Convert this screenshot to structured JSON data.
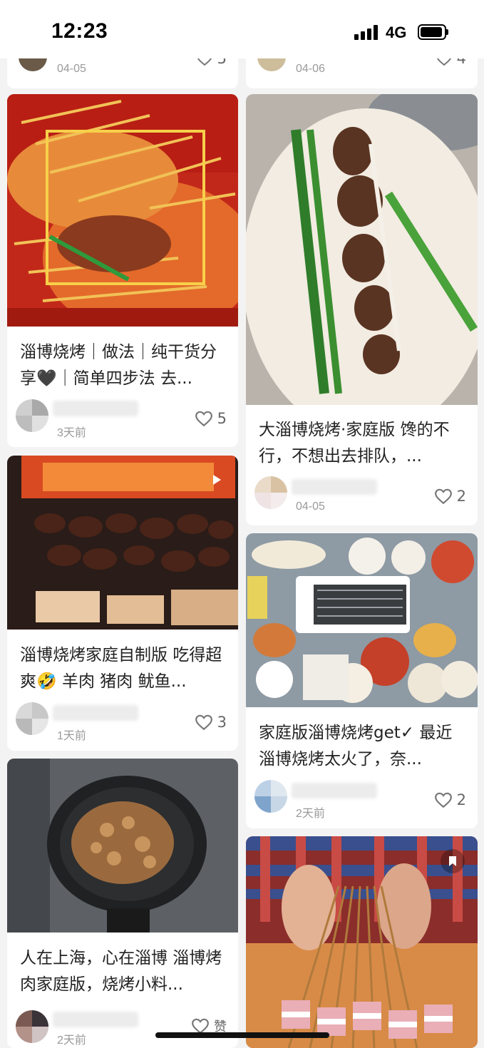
{
  "status_bar": {
    "time": "12:23",
    "network": "4G"
  },
  "feed": {
    "left": [
      {
        "date": "04-05",
        "likes": "5"
      },
      {
        "title": "淄博烧烤｜做法｜纯干货分享🖤｜简单四步法 去...",
        "date": "3天前",
        "likes": "5"
      },
      {
        "title": "淄博烧烤家庭自制版 吃得超爽🤣 羊肉 猪肉 鱿鱼...",
        "date": "1天前",
        "likes": "3",
        "video_icon": "play-icon"
      },
      {
        "title": "人在上海，心在淄博 淄博烤肉家庭版，烧烤小料...",
        "date": "2天前",
        "likes": "赞"
      }
    ],
    "right": [
      {
        "date": "04-06",
        "likes": "4"
      },
      {
        "title": "大淄博烧烤·家庭版 馋的不行，不想出去排队，...",
        "date": "04-05",
        "likes": "2"
      },
      {
        "title": "家庭版淄博烧烤get✓ 最近淄博烧烤太火了，奈...",
        "date": "2天前",
        "likes": "2"
      },
      {
        "badge_icon": "bookmark-icon"
      }
    ]
  },
  "icons": {
    "like": "heart-outline-icon",
    "signal": "signal-bars-icon",
    "battery": "battery-icon"
  },
  "colors": {
    "background": "#f3f3f3",
    "card": "#ffffff",
    "text": "#222222",
    "meta": "#9a9a9a"
  }
}
